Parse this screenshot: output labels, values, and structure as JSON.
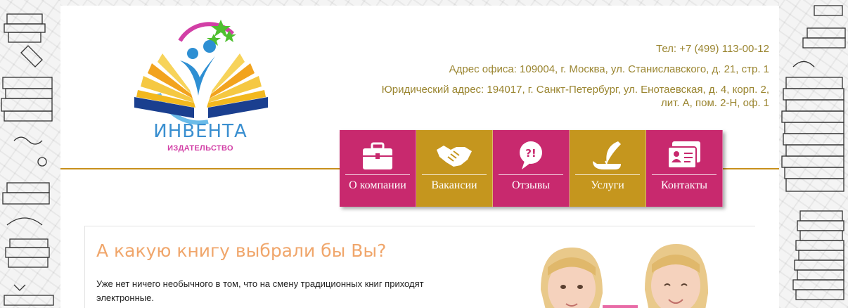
{
  "logo": {
    "title": "ИНВЕНТА",
    "subtitle": "ИЗДАТЕЛЬСТВО"
  },
  "contacts": {
    "phone": "Тел: +7 (499) 113-00-12",
    "office_address": "Адрес офиса: 109004, г. Москва, ул. Станиславского, д. 21, стр. 1",
    "legal_address_line1": "Юридический адрес: 194017, г. Санкт-Петербург, ул. Енотаевская, д. 4, корп. 2,",
    "legal_address_line2": "лит. А, пом. 2-Н, оф. 1"
  },
  "nav": {
    "items": [
      {
        "label": "О компании",
        "icon": "briefcase-icon",
        "color": "#c8296e"
      },
      {
        "label": "Вакансии",
        "icon": "handshake-icon",
        "color": "#c5961e"
      },
      {
        "label": "Отзывы",
        "icon": "speech-bubble-icon",
        "color": "#c8296e"
      },
      {
        "label": "Услуги",
        "icon": "quill-icon",
        "color": "#c5961e"
      },
      {
        "label": "Контакты",
        "icon": "contact-card-icon",
        "color": "#c8296e"
      }
    ]
  },
  "article": {
    "heading": "А какую книгу выбрали бы Вы?",
    "intro": "Уже нет ничего необычного в том, что на смену традиционных книг приходят электронные."
  },
  "colors": {
    "pink": "#c8296e",
    "gold": "#c5961e",
    "contact_text": "#9a8530",
    "heading": "#f0a66b"
  }
}
